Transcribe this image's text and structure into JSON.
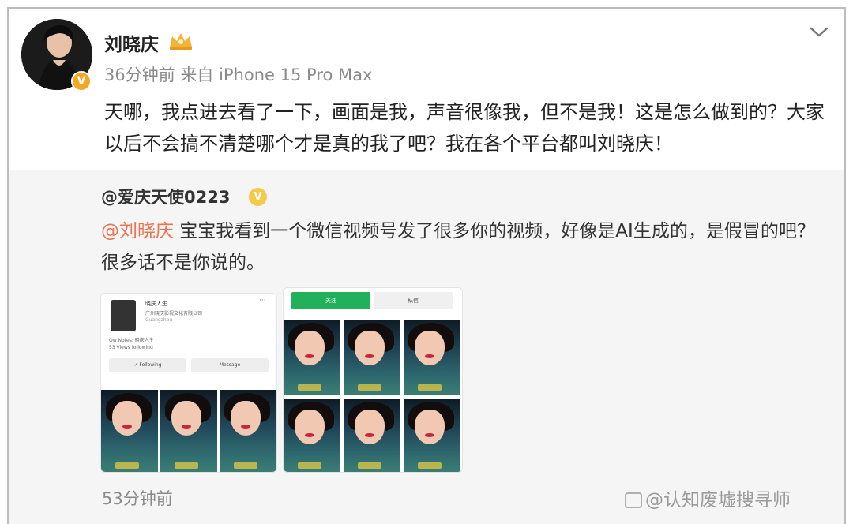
{
  "post": {
    "username": "刘晓庆",
    "meta": "36分钟前  来自 iPhone 15 Pro Max",
    "text": "天哪，我点进去看了一下，画面是我，声音很像我，但不是我！这是怎么做到的？大家以后不会搞不清楚哪个才是真的我了吧？我在各个平台都叫刘晓庆！",
    "verified_icon": "verified-badge-icon",
    "crown_icon": "crown-icon"
  },
  "repost": {
    "username": "@爱庆天使0223",
    "verified_icon": "verified-badge-icon",
    "mention": "@刘晓庆",
    "text": " 宝宝我看到一个微信视频号发了很多你的视频，好像是AI生成的，是假冒的吧？很多话不是你说的。",
    "image1": {
      "name": "晓庆人生",
      "subtitle": "广州晓庆影视文化有限公司",
      "sub2": "Guangzhou",
      "bio1": "Ow Notes: 晓庆人生",
      "bio2": "53 Views  following",
      "btn_follow": "✓ Following",
      "btn_message": "Message",
      "dots": "···"
    },
    "image2": {
      "tab_active": "关注",
      "tab_inactive": "私信"
    }
  },
  "footer": {
    "time": "53分钟前",
    "watermark": "@认知废墟搜寻师"
  },
  "colors": {
    "mention": "#eb7350",
    "badge_orange": "#f5a623",
    "badge_yellow": "#f7c948",
    "tab_green": "#20b15a"
  }
}
